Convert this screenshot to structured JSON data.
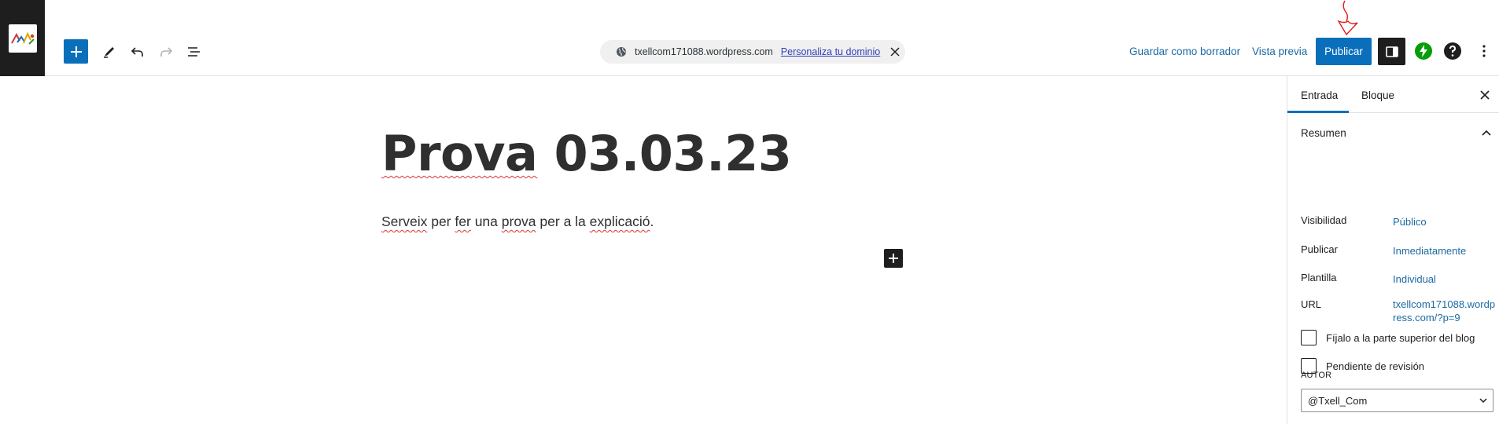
{
  "toolbar": {
    "domain": "txellcom171088.wordpress.com",
    "customize_domain": "Personaliza tu dominio",
    "save_draft": "Guardar como borrador",
    "preview": "Vista previa",
    "publish": "Publicar"
  },
  "icons": {
    "site": "site-logo-icon",
    "add": "plus-icon",
    "tools": "pencil-icon",
    "undo": "undo-icon",
    "redo": "redo-icon",
    "list_view": "list-view-icon",
    "globe": "globe-icon",
    "close": "close-icon",
    "settings": "sidebar-toggle-icon",
    "jetpack": "jetpack-bolt-icon",
    "help": "help-icon",
    "more": "more-vertical-icon",
    "chevron_up": "chevron-up-icon",
    "chevron_down": "chevron-down-icon"
  },
  "editor": {
    "title_words": [
      "Prova",
      " 03.03.23"
    ],
    "paragraph_parts": [
      {
        "text": "Serveix",
        "spell": true
      },
      {
        "text": " per ",
        "spell": false
      },
      {
        "text": "fer",
        "spell": true
      },
      {
        "text": " una ",
        "spell": false
      },
      {
        "text": "prova",
        "spell": true
      },
      {
        "text": " per a la ",
        "spell": false
      },
      {
        "text": "explicació",
        "spell": true
      },
      {
        "text": ".",
        "spell": false
      }
    ]
  },
  "sidebar": {
    "tabs": [
      {
        "label": "Entrada",
        "active": true
      },
      {
        "label": "Bloque",
        "active": false
      }
    ],
    "summary_title": "Resumen",
    "rows": [
      {
        "label": "Visibilidad",
        "value": "Público"
      },
      {
        "label": "Publicar",
        "value": "Inmediatamente"
      },
      {
        "label": "Plantilla",
        "value": "Individual"
      },
      {
        "label": "URL",
        "value": "txellcom171088.wordpress.com/?p=9"
      }
    ],
    "checkboxes": [
      {
        "label": "Fíjalo a la parte superior del blog",
        "checked": false
      },
      {
        "label": "Pendiente de revisión",
        "checked": false
      }
    ],
    "author_label": "Autor",
    "author_value": "@Txell_Com"
  },
  "colors": {
    "accent": "#0a6fbb",
    "link": "#1b6aa3",
    "dark": "#1e1e1e",
    "annotation": "#e01b1b",
    "jetpack": "#069e08"
  }
}
